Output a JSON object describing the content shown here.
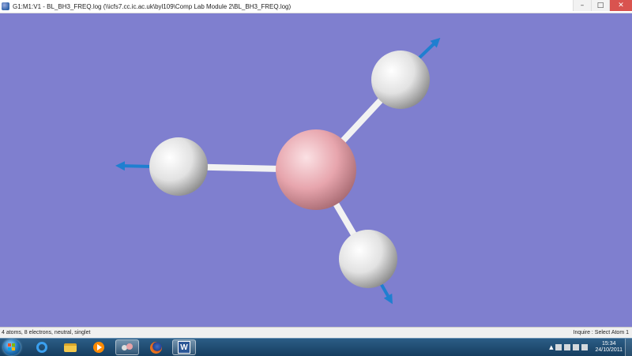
{
  "window": {
    "title": "G1:M1:V1 - BL_BH3_FREQ.log (\\\\icfs7.cc.ic.ac.uk\\byl109\\Comp Lab Module 2\\BL_BH3_FREQ.log)",
    "minimize_glyph": "–",
    "maximize_glyph": "□",
    "close_glyph": "✕"
  },
  "viewport": {
    "background": "#7f7fcf",
    "molecule": "BH3",
    "atoms": [
      "B",
      "H",
      "H",
      "H"
    ],
    "atom_colors": {
      "B": "#e8a3ab",
      "H": "#e6e6e6"
    },
    "vector_color": "#1f7fd0"
  },
  "status": {
    "left": "4 atoms, 8 electrons, neutral, singlet",
    "right": "Inquire : Select Atom 1"
  },
  "taskbar": {
    "apps": [
      {
        "name": "internet-explorer-icon"
      },
      {
        "name": "folder-icon"
      },
      {
        "name": "media-player-icon"
      },
      {
        "name": "gaussview-icon"
      },
      {
        "name": "firefox-icon"
      },
      {
        "name": "word-icon",
        "label": "W"
      }
    ],
    "clock_time": "15:34",
    "clock_date": "24/10/2011",
    "tray_arrow": "▲"
  }
}
